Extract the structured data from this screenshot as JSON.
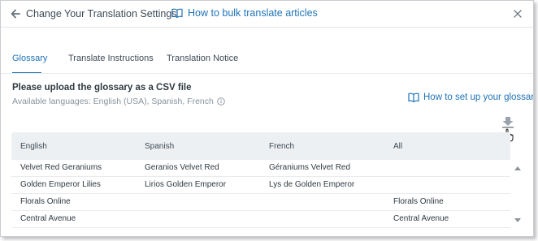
{
  "header": {
    "title": "Change Your Translation Settings",
    "help_link": "How to bulk translate articles"
  },
  "tabs": [
    {
      "label": "Glossary",
      "active": true
    },
    {
      "label": "Translate Instructions",
      "active": false
    },
    {
      "label": "Translation Notice",
      "active": false
    }
  ],
  "upload": {
    "title": "Please upload the glossary as a CSV file",
    "languages": "Available languages: English (USA), Spanish, French",
    "setup_link": "How to set up your glossary?"
  },
  "table": {
    "columns": [
      "English",
      "Spanish",
      "French",
      "All"
    ],
    "rows": [
      [
        "Velvet Red Geraniums",
        "Geranios Velvet Red",
        "Géraniums Velvet Red",
        ""
      ],
      [
        "Golden Emperor Lilies",
        "Lirios Golden Emperor",
        "Lys de Golden Emperor",
        ""
      ],
      [
        "Florals Online",
        "",
        "",
        "Florals Online"
      ],
      [
        "Central Avenue",
        "",
        "",
        "Central Avenue"
      ]
    ]
  },
  "icons": {
    "back": "arrow-left-icon",
    "help": "book-open-icon",
    "close": "close-icon",
    "info": "info-icon",
    "download": "download-icon"
  },
  "colors": {
    "accent": "#1f73b7",
    "text": "#2f3941",
    "muted": "#87929d",
    "table_header_bg": "#edf0f2"
  }
}
